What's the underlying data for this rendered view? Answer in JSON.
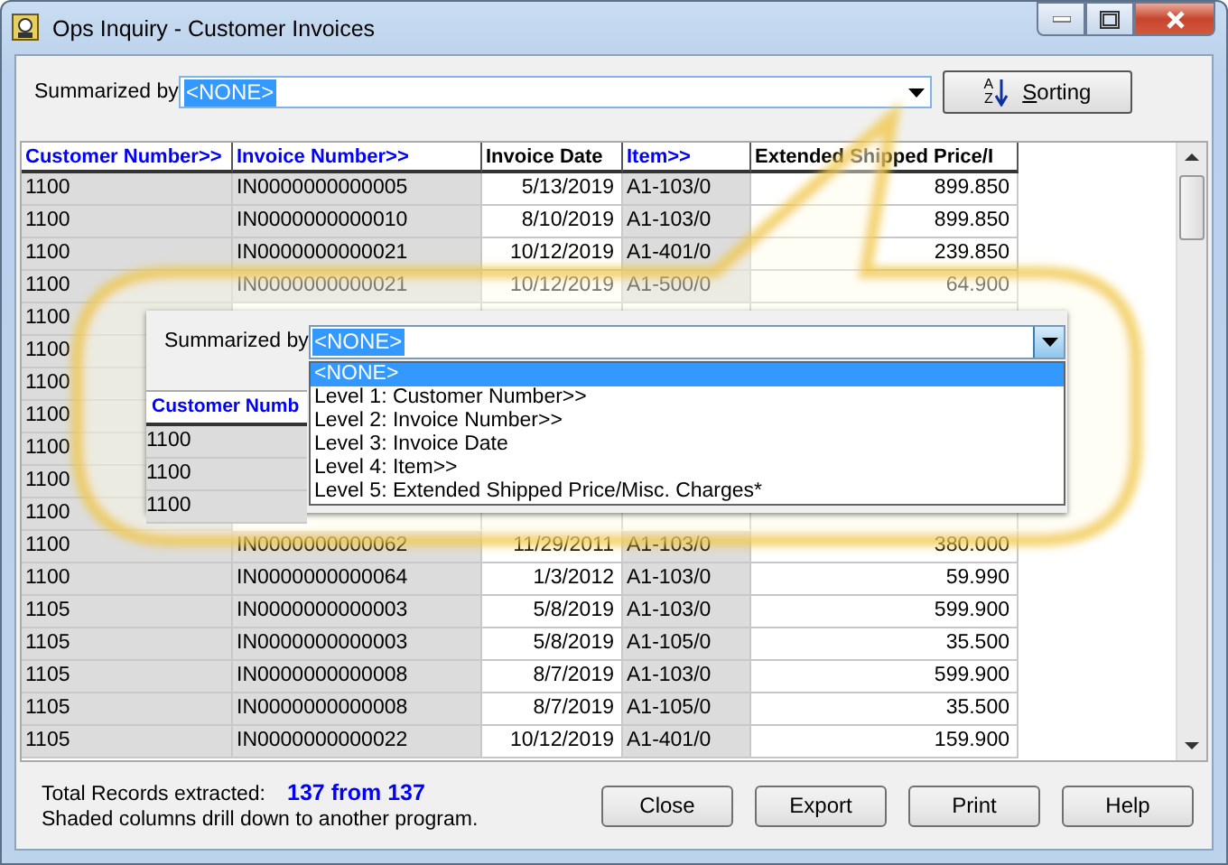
{
  "window": {
    "title": "Ops Inquiry - Customer Invoices"
  },
  "summarized_by": {
    "label": "Summarized by",
    "value": "<NONE>"
  },
  "sorting_button": {
    "label": "Sorting",
    "icon_letters": [
      "A",
      "Z"
    ]
  },
  "table": {
    "columns": [
      {
        "label": "Customer Number>>",
        "drill": true
      },
      {
        "label": "Invoice Number>>",
        "drill": true
      },
      {
        "label": "Invoice Date",
        "drill": false
      },
      {
        "label": "Item>>",
        "drill": true
      },
      {
        "label": "Extended Shipped Price/I",
        "drill": false
      }
    ],
    "rows": [
      {
        "cells": [
          "1100",
          "IN0000000000005",
          "5/13/2019",
          "A1-103/0",
          "899.850"
        ]
      },
      {
        "cells": [
          "1100",
          "IN0000000000010",
          "8/10/2019",
          "A1-103/0",
          "899.850"
        ]
      },
      {
        "cells": [
          "1100",
          "IN0000000000021",
          "10/12/2019",
          "A1-401/0",
          "239.850"
        ]
      },
      {
        "cells": [
          "1100",
          "IN0000000000021",
          "10/12/2019",
          "A1-500/0",
          "64.900"
        ]
      },
      {
        "cells": [
          "1100"
        ]
      },
      {
        "cells": [
          "1100"
        ]
      },
      {
        "cells": [
          "1100"
        ]
      },
      {
        "cells": [
          "1100"
        ]
      },
      {
        "cells": [
          "1100"
        ]
      },
      {
        "cells": [
          "1100"
        ]
      },
      {
        "cells": [
          "1100"
        ]
      },
      {
        "cells": [
          "1100",
          "IN0000000000062",
          "11/29/2011",
          "A1-103/0",
          "380.000"
        ]
      },
      {
        "cells": [
          "1100",
          "IN0000000000064",
          "1/3/2012",
          "A1-103/0",
          "59.990"
        ]
      },
      {
        "cells": [
          "1105",
          "IN0000000000003",
          "5/8/2019",
          "A1-103/0",
          "599.900"
        ]
      },
      {
        "cells": [
          "1105",
          "IN0000000000003",
          "5/8/2019",
          "A1-105/0",
          "35.500"
        ]
      },
      {
        "cells": [
          "1105",
          "IN0000000000008",
          "8/7/2019",
          "A1-103/0",
          "599.900"
        ]
      },
      {
        "cells": [
          "1105",
          "IN0000000000008",
          "8/7/2019",
          "A1-105/0",
          "35.500"
        ]
      },
      {
        "cells": [
          "1105",
          "IN0000000000022",
          "10/12/2019",
          "A1-401/0",
          "159.900"
        ]
      }
    ]
  },
  "callout": {
    "summarized_by": {
      "label": "Summarized by",
      "value": "<NONE>"
    },
    "options": [
      {
        "label": "<NONE>",
        "selected": true
      },
      {
        "label": "Level 1: Customer Number>>",
        "selected": false
      },
      {
        "label": "Level 2: Invoice Number>>",
        "selected": false
      },
      {
        "label": "Level 3: Invoice Date",
        "selected": false
      },
      {
        "label": "Level 4: Item>>",
        "selected": false
      },
      {
        "label": "Level 5: Extended Shipped Price/Misc. Charges*",
        "selected": false
      }
    ],
    "column_header": "Customer Numb",
    "cells": [
      "1100",
      "1100",
      "1100"
    ]
  },
  "footer": {
    "total_label": "Total Records extracted:",
    "total_value": "137 from 137",
    "note": "Shaded columns drill down to another program."
  },
  "buttons": [
    "Close",
    "Export",
    "Print",
    "Help"
  ]
}
